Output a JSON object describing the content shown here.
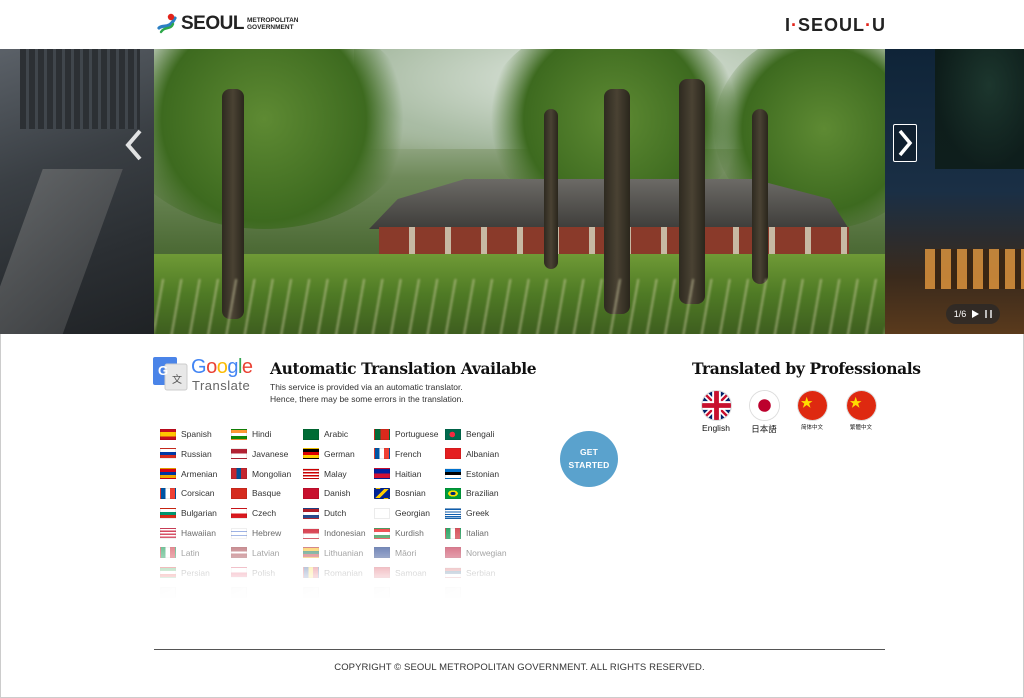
{
  "header": {
    "logo_main": "SEOUL",
    "logo_sub_line1": "METROPOLITAN",
    "logo_sub_line2": "GOVERNMENT",
    "brand_right": "I·SEOUL·U"
  },
  "slider": {
    "counter": "1/6",
    "prev_icon": "chevron-left-icon",
    "next_icon": "chevron-right-icon",
    "play_icon": "play-icon",
    "pause_icon": "pause-icon"
  },
  "google": {
    "word": "Google",
    "sub": "Translate",
    "title": "Automatic Translation Available",
    "desc_line1": "This service is provided via an automatic translator.",
    "desc_line2": "Hence, there may be some errors in the translation."
  },
  "languages": [
    [
      "Spanish",
      "Hindi",
      "Arabic",
      "Portuguese",
      "Bengali"
    ],
    [
      "Russian",
      "Javanese",
      "German",
      "French",
      "Albanian"
    ],
    [
      "Armenian",
      "Mongolian",
      "Malay",
      "Haitian",
      "Estonian"
    ],
    [
      "Corsican",
      "Basque",
      "Danish",
      "Bosnian",
      "Brazilian"
    ],
    [
      "Bulgarian",
      "Czech",
      "Dutch",
      "Georgian",
      "Greek"
    ],
    [
      "Hawaiian",
      "Hebrew",
      "Indonesian",
      "Kurdish",
      "Italian"
    ],
    [
      "Latin",
      "Latvian",
      "Lithuanian",
      "Māori",
      "Norwegian"
    ],
    [
      "Persian",
      "Polish",
      "Romanian",
      "Samoan",
      "Serbian"
    ],
    [
      "",
      "",
      "",
      "",
      ""
    ]
  ],
  "get_started": {
    "line1": "GET",
    "line2": "STARTED"
  },
  "professional": {
    "title": "Translated by Professionals",
    "items": [
      {
        "label": "English"
      },
      {
        "label": "日本語"
      },
      {
        "label": "简体中文"
      },
      {
        "label": "繁體中文"
      }
    ]
  },
  "footer": {
    "copyright": "COPYRIGHT © SEOUL METROPOLITAN GOVERNMENT. ALL RIGHTS RESERVED."
  },
  "colors": {
    "get_started_bg": "#5aa2cd",
    "brand_dot": "#e2231a"
  }
}
